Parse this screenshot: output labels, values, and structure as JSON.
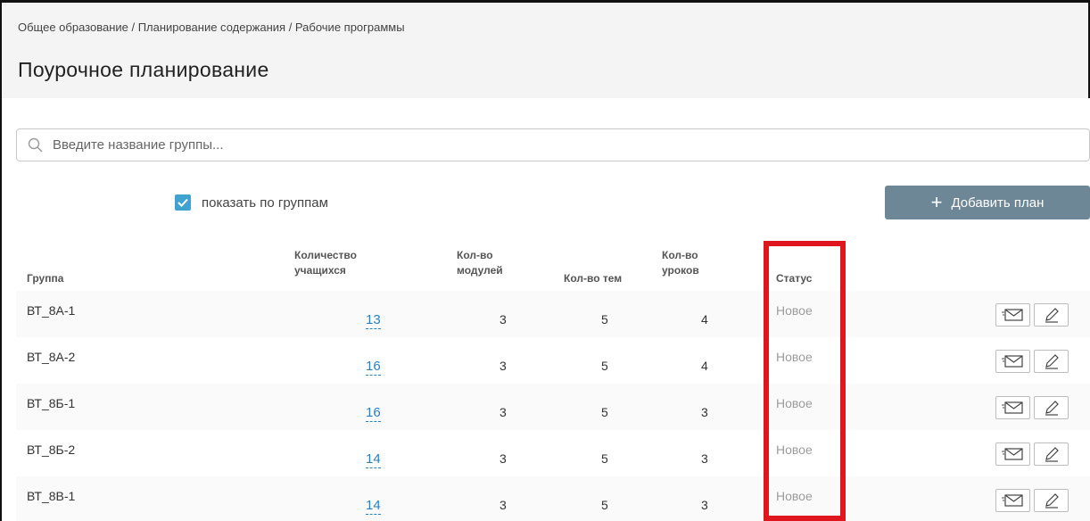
{
  "breadcrumb": "Общее образование / Планирование содержания / Рабочие программы",
  "page_title": "Поурочное планирование",
  "search": {
    "placeholder": "Введите название группы..."
  },
  "toggle": {
    "label": "показать по группам",
    "checked": true
  },
  "add_button": {
    "label": "Добавить план"
  },
  "columns": {
    "group": "Группа",
    "students_1": "Количество",
    "students_2": "учащихся",
    "modules_1": "Кол-во",
    "modules_2": "модулей",
    "topics": "Кол-во тем",
    "lessons_1": "Кол-во",
    "lessons_2": "уроков",
    "status": "Статус"
  },
  "rows": [
    {
      "group": "ВТ_8А-1",
      "students": "13",
      "modules": "3",
      "topics": "5",
      "lessons": "4",
      "status": "Новое"
    },
    {
      "group": "ВТ_8А-2",
      "students": "16",
      "modules": "3",
      "topics": "5",
      "lessons": "4",
      "status": "Новое"
    },
    {
      "group": "ВТ_8Б-1",
      "students": "16",
      "modules": "3",
      "topics": "5",
      "lessons": "3",
      "status": "Новое"
    },
    {
      "group": "ВТ_8Б-2",
      "students": "14",
      "modules": "3",
      "topics": "5",
      "lessons": "3",
      "status": "Новое"
    },
    {
      "group": "ВТ_8В-1",
      "students": "14",
      "modules": "3",
      "topics": "5",
      "lessons": "3",
      "status": "Новое"
    }
  ],
  "colors": {
    "accent": "#3fa2cf",
    "button": "#6e8797",
    "link": "#2d7fbd",
    "highlight": "#e0161f"
  }
}
